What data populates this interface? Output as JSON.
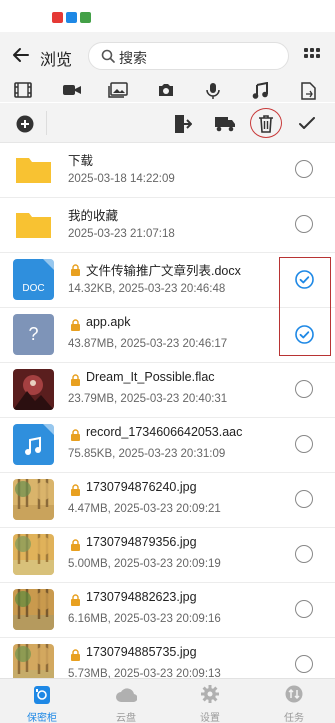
{
  "header": {
    "title": "浏览",
    "search_placeholder": "搜索"
  },
  "files": [
    {
      "name": "下载",
      "meta": "2025-03-18 14:22:09",
      "type": "folder",
      "locked": false,
      "selected": false
    },
    {
      "name": "我的收藏",
      "meta": "2025-03-23 21:07:18",
      "type": "folder",
      "locked": false,
      "selected": false
    },
    {
      "name": "文件传输推广文章列表.docx",
      "meta": "14.32KB, 2025-03-23 20:46:48",
      "type": "doc",
      "badge": "DOC",
      "locked": true,
      "selected": true
    },
    {
      "name": "app.apk",
      "meta": "43.87MB, 2025-03-23 20:46:17",
      "type": "unknown",
      "badge": "?",
      "locked": true,
      "selected": true
    },
    {
      "name": "Dream_It_Possible.flac",
      "meta": "23.79MB, 2025-03-23 20:40:31",
      "type": "audio-cover",
      "locked": true,
      "selected": false
    },
    {
      "name": "record_1734606642053.aac",
      "meta": "75.85KB, 2025-03-23 20:31:09",
      "type": "audio",
      "locked": true,
      "selected": false
    },
    {
      "name": "1730794876240.jpg",
      "meta": "4.47MB, 2025-03-23 20:09:21",
      "type": "image",
      "locked": true,
      "selected": false
    },
    {
      "name": "1730794879356.jpg",
      "meta": "5.00MB, 2025-03-23 20:09:19",
      "type": "image",
      "locked": true,
      "selected": false
    },
    {
      "name": "1730794882623.jpg",
      "meta": "6.16MB, 2025-03-23 20:09:16",
      "type": "image",
      "locked": true,
      "selected": false
    },
    {
      "name": "1730794885735.jpg",
      "meta": "5.73MB, 2025-03-23 20:09:13",
      "type": "image",
      "locked": true,
      "selected": false
    }
  ],
  "tabs": [
    {
      "label": "保密柜",
      "icon": "vault-icon",
      "active": true
    },
    {
      "label": "云盘",
      "icon": "cloud-icon",
      "active": false
    },
    {
      "label": "设置",
      "icon": "gear-icon",
      "active": false
    },
    {
      "label": "任务",
      "icon": "task-icon",
      "active": false
    }
  ],
  "colors": {
    "accent": "#1e88e5",
    "folder": "#f8c232",
    "doc": "#2f8fdd",
    "unknown": "#7e94b8",
    "highlight": "#b83333"
  }
}
